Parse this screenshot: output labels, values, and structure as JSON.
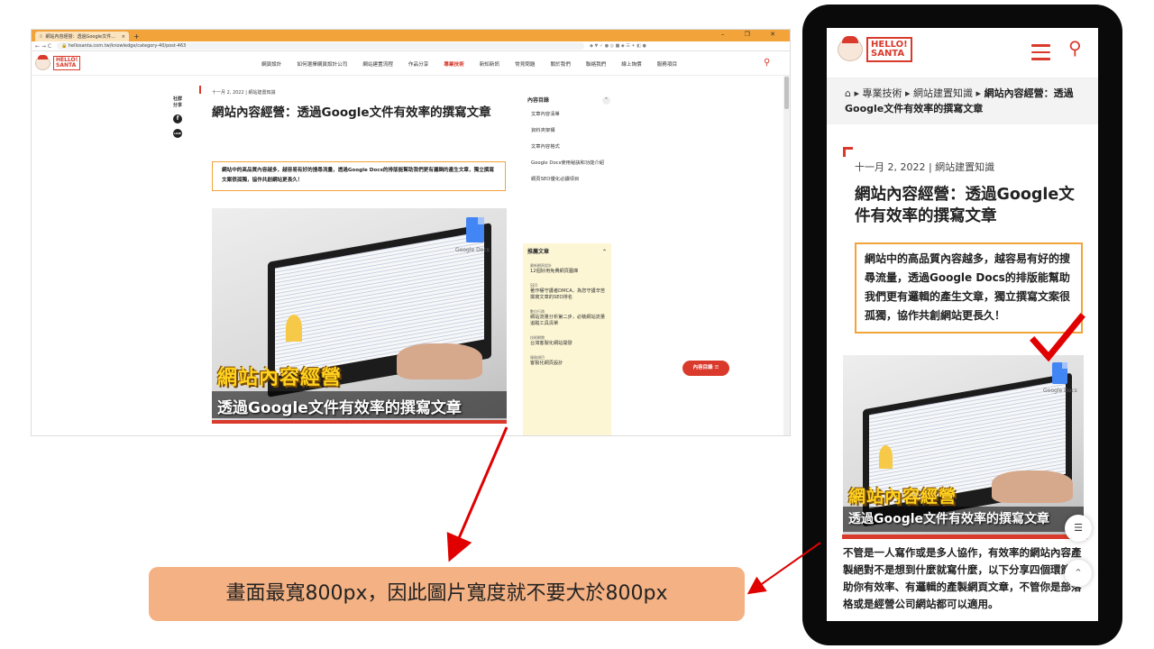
{
  "desktop": {
    "tab_title": "網站內容經營：透過Google文件...",
    "tab_close": "×",
    "tab_new": "+",
    "window_controls": "– ❐ ✕",
    "nav_icons": "← → C",
    "url": "hellosanta.com.tw/knowledge/category-40/post-463",
    "logo_line1": "HELLO!",
    "logo_line2": "SANTA",
    "menu": [
      {
        "label": "網頁設計"
      },
      {
        "label": "如何選擇網頁設計公司"
      },
      {
        "label": "網站建置流程"
      },
      {
        "label": "作品分享"
      },
      {
        "label": "專業技術"
      },
      {
        "label": "新知新訊"
      },
      {
        "label": "常見問題"
      },
      {
        "label": "關於我們"
      },
      {
        "label": "聯絡我們"
      },
      {
        "label": "線上詢價"
      },
      {
        "label": "服務項目"
      }
    ],
    "share_label_1": "社群",
    "share_label_2": "分享",
    "share_fb": "f",
    "share_line": "LINE",
    "meta": "十一月 2, 2022 | 網站建置知識",
    "title": "網站內容經營：透過Google文件有效率的撰寫文章",
    "summary": "網站中的高品質內容越多，越容易有好的搜尋流量，透過Google Docs的排版能幫助我們更有邏輯的產生文章，獨立撰寫文案很孤獨，協作共創網站更長久！",
    "toc_title": "內容目錄",
    "toc_items": [
      {
        "label": "文章內容清單"
      },
      {
        "label": "資料夾架構"
      },
      {
        "label": "文章內容格式"
      },
      {
        "label": "Google Docs使用秘訣和功能介紹"
      },
      {
        "label": "網頁SEO優化必讀項目"
      }
    ],
    "rec_title": "推薦文章",
    "rec_items": [
      {
        "cat": "最新網頁設計",
        "title": "12個好用免費網頁圖庫"
      },
      {
        "cat": "SEO",
        "title": "著作權守護者DMCA，為您守護辛苦撰寫文章的SEO排名"
      },
      {
        "cat": "數位行銷",
        "title": "網站流量分析第二步，必裝網站流量追蹤工具清單"
      },
      {
        "cat": "技術網閱",
        "title": "台灣客製化網站開發"
      },
      {
        "cat": "服務項目",
        "title": "客製化網頁設計"
      }
    ],
    "toc_button": "內容目錄 ☰",
    "hero_title": "網站內容經營",
    "hero_subtitle": "透過Google文件有效率的撰寫文章",
    "gdocs_label": "Google Docs"
  },
  "mobile": {
    "logo_line1": "HELLO!",
    "logo_line2": "SANTA",
    "breadcrumb_home": "⌂",
    "breadcrumb_1": "專業技術",
    "breadcrumb_2": "網站建置知識",
    "breadcrumb_current": "網站內容經營：透過Google文件有效率的撰寫文章",
    "meta": "十一月 2, 2022 | 網站建置知識",
    "title": "網站內容經營：透過Google文件有效率的撰寫文章",
    "summary": "網站中的高品質內容越多，越容易有好的搜尋流量，透過Google Docs的排版能幫助我們更有邏輯的產生文章，獨立撰寫文案很孤獨，協作共創網站更長久！",
    "hero_title": "網站內容經營",
    "hero_subtitle": "透過Google文件有效率的撰寫文章",
    "gdocs_label": "Google Docs",
    "body": "不管是一人寫作或是多人協作，有效率的網站內容產製絕對不是想到什麼就寫什麼，以下分享四個環節幫助你有效率、有邏輯的產製網頁文章，不管你是部落格或是經營公司網站都可以適用。",
    "toc_fab": "☰",
    "top_fab": "⌃"
  },
  "annotation": {
    "callout": "畫面最寬800px，因此圖片寬度就不要大於800px",
    "accent_red": "#d93a2b",
    "callout_bg": "#f4b183"
  }
}
